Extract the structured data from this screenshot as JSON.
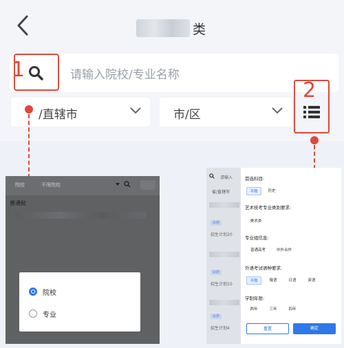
{
  "header": {
    "back_icon": "chevron-left-icon",
    "title_suffix": "类"
  },
  "search": {
    "annotation_number": "1",
    "placeholder": "请输入院校/专业名称"
  },
  "filters": {
    "province_label": "省/直辖市",
    "province_visible": "/直辖市",
    "city_label": "市/区"
  },
  "list_button": {
    "annotation_number": "2",
    "icon": "list-icon"
  },
  "accent_colors": {
    "annotation": "#e0493a",
    "primary": "#2f78e8"
  },
  "left_screenshot": {
    "top_label_1": "院校",
    "top_label_2": "不限院校",
    "section_label": "普通批",
    "dialog_options": [
      {
        "label": "院校",
        "selected": true
      },
      {
        "label": "专业",
        "selected": false
      }
    ]
  },
  "right_screenshot": {
    "left_search_text": "请输入",
    "left_filter_text": "省/直辖市",
    "left_tags": [
      "公办",
      "公办",
      "公办"
    ],
    "left_rows": [
      "招生计划20",
      "招生计划10",
      "招生计划4"
    ],
    "panel": {
      "sections": [
        {
          "title": "首选科目:",
          "chips": [
            {
              "label": "不限",
              "selected": true
            },
            {
              "label": "历史",
              "selected": false
            }
          ]
        },
        {
          "title": "艺术统考专业类别要求:",
          "chips": [
            {
              "label": "美术类",
              "selected": false
            }
          ]
        },
        {
          "title": "专业组信息:",
          "chips": [
            {
              "label": "普通高考",
              "selected": false
            },
            {
              "label": "中外合作",
              "selected": false
            }
          ]
        },
        {
          "title": "外语考试语种要求:",
          "chips": [
            {
              "label": "不限",
              "selected": true
            },
            {
              "label": "俄语",
              "selected": false
            },
            {
              "label": "日语",
              "selected": false
            },
            {
              "label": "英语",
              "selected": false
            }
          ]
        },
        {
          "title": "学制年限:",
          "chips": [
            {
              "label": "两年",
              "selected": false
            },
            {
              "label": "三年",
              "selected": false
            },
            {
              "label": "四年",
              "selected": false
            }
          ]
        }
      ],
      "reset_label": "重置",
      "confirm_label": "确定"
    }
  }
}
